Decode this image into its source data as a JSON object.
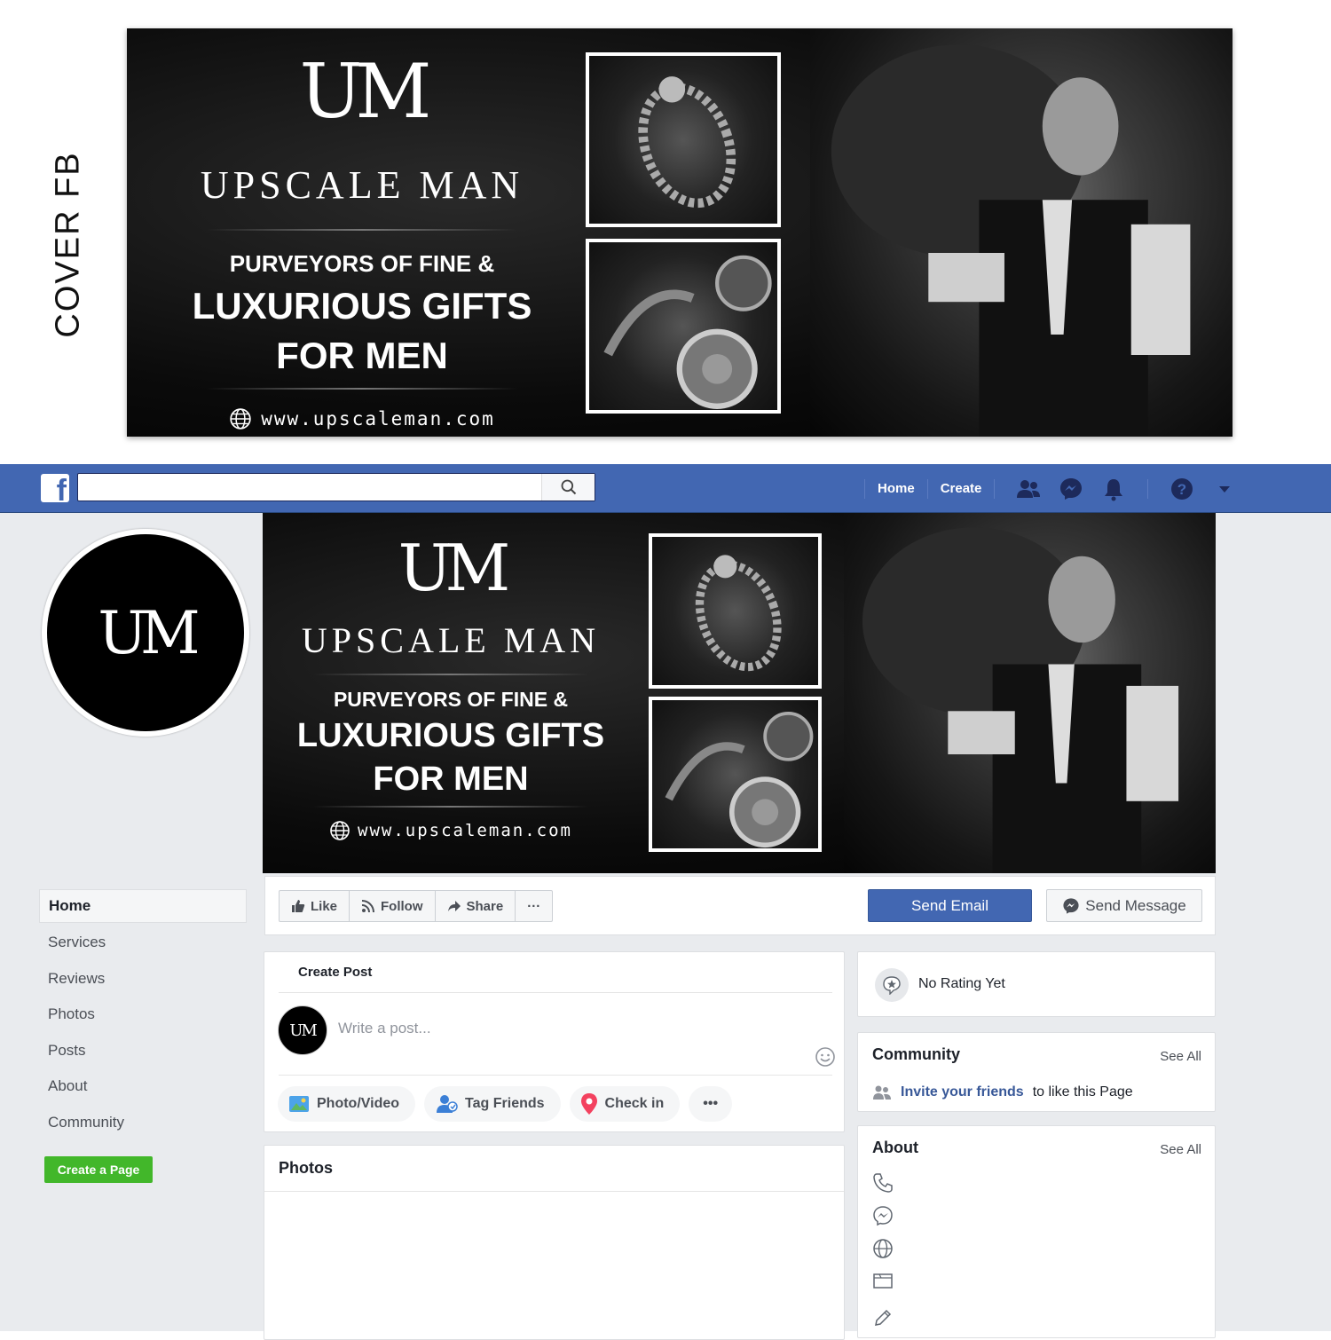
{
  "side_label": "COVER FB",
  "cover": {
    "logo_mark": "UM",
    "brand_name": "UPSCALE MAN",
    "tagline_1": "PURVEYORS OF FINE &",
    "tagline_2": "LUXURIOUS GIFTS",
    "tagline_3": "FOR MEN",
    "url": "www.upscaleman.com"
  },
  "fb_nav": {
    "logo": "f",
    "search_placeholder": "",
    "home": "Home",
    "create": "Create",
    "icons": [
      "friends-icon",
      "messenger-icon",
      "notifications-icon",
      "help-icon",
      "dropdown-icon"
    ]
  },
  "profile": {
    "logo_mark": "UM"
  },
  "left_nav": {
    "items": [
      "Home",
      "Services",
      "Reviews",
      "Photos",
      "Posts",
      "About",
      "Community"
    ],
    "create_page": "Create a Page"
  },
  "actions": {
    "like": "Like",
    "follow": "Follow",
    "share": "Share",
    "more": "···",
    "send_email": "Send Email",
    "send_message": "Send Message"
  },
  "create_post": {
    "title": "Create Post",
    "placeholder": "Write a post...",
    "avatar_mark": "UM",
    "photo_video": "Photo/Video",
    "tag_friends": "Tag Friends",
    "check_in": "Check in",
    "more": "•••"
  },
  "photos": {
    "title": "Photos"
  },
  "rating": {
    "text": "No Rating Yet"
  },
  "community": {
    "title": "Community",
    "see_all": "See All",
    "invite_link": "Invite your friends",
    "invite_rest": "to like this Page"
  },
  "about": {
    "title": "About",
    "see_all": "See All",
    "icons": [
      "phone-icon",
      "messenger-icon",
      "globe-icon",
      "category-icon",
      "edit-icon"
    ]
  },
  "colors": {
    "fb_blue": "#4267b2",
    "green": "#42b72a",
    "body_bg": "#e9ebee"
  }
}
